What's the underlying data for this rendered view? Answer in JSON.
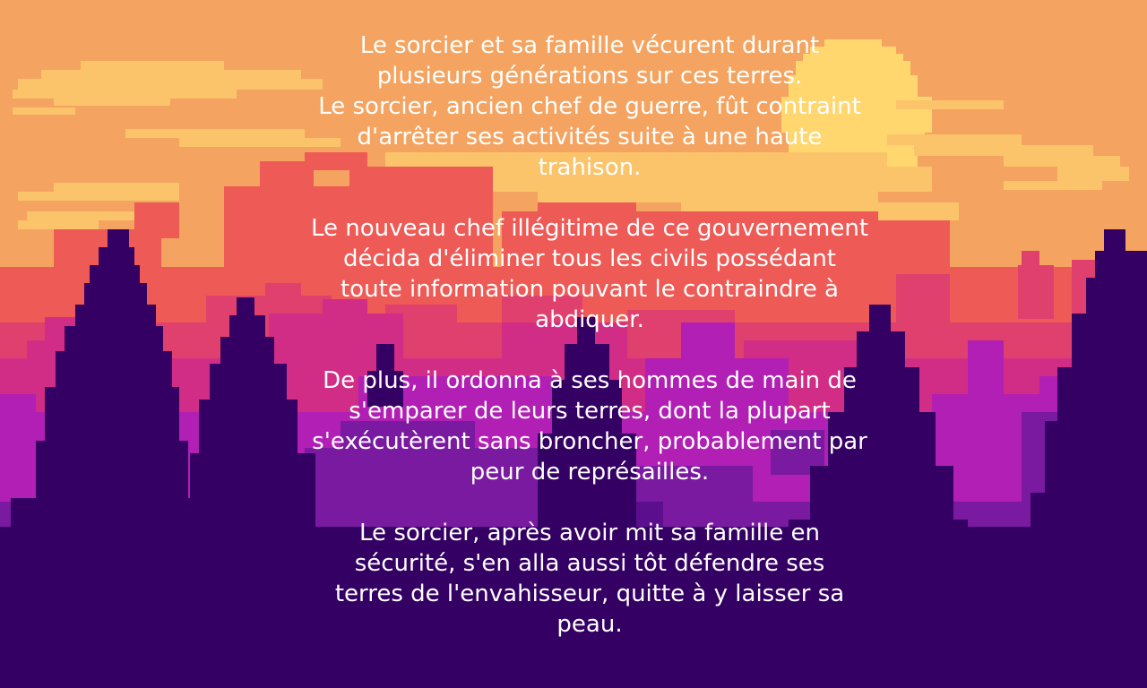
{
  "palette": {
    "sky": "#f4a460",
    "cloud": "#fbc46a",
    "sun": "#ffd76e",
    "ridge_far": "#ee5a55",
    "ridge_mid": "#e0406e",
    "ridge_near": "#d12d86",
    "magenta": "#b11fb4",
    "violet": "#7a1aa0",
    "deep": "#5c0f8c",
    "dark": "#340063",
    "text": "#ffffff"
  },
  "story": {
    "paragraphs": [
      "Le sorcier et sa famille vécurent durant\nplusieurs générations sur ces terres.\nLe sorcier, ancien chef de guerre, fût contraint\nd'arrêter ses activités suite à une haute\ntrahison.",
      "Le nouveau chef illégitime de ce gouvernement\ndécida d'éliminer tous les civils possédant\ntoute information pouvant le contraindre à\nabdiquer.",
      "De plus, il ordonna à ses hommes de main de\ns'emparer de leurs terres, dont la plupart\ns'exécutèrent sans broncher, probablement par\npeur de représailles.",
      "Le sorcier, après avoir mit sa famille en\nsécurité,  s'en alla    aussi tôt défendre ses\nterres de l'envahisseur, quitte à y laisser sa\npeau."
    ]
  }
}
